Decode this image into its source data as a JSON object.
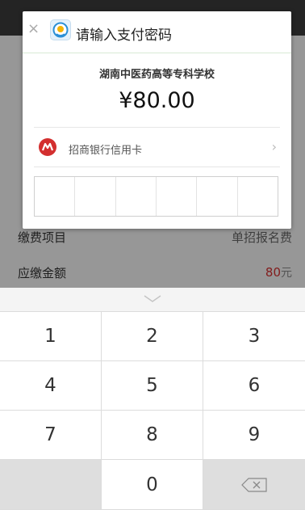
{
  "background_rows": [
    {
      "label": "缴费项目",
      "value": "单招报名费",
      "value_color": "#777777"
    },
    {
      "label": "应缴金额",
      "value": "80",
      "unit": "元",
      "value_color": "#d32f2f"
    }
  ],
  "dialog": {
    "close_icon": "×",
    "title": "请输入支付密码",
    "merchant": "湖南中医药高等专科学校",
    "amount": "¥80.00",
    "payment_method": "招商银行信用卡",
    "payment_chevron": "›",
    "password_cells": 6
  },
  "keyboard": {
    "keys": [
      "1",
      "2",
      "3",
      "4",
      "5",
      "6",
      "7",
      "8",
      "9",
      "",
      "0",
      "⌫"
    ]
  },
  "colors": {
    "accent_red": "#d32f2f",
    "overlay": "rgba(0,0,0,0.38)",
    "header_divider": "#d9ead5"
  }
}
